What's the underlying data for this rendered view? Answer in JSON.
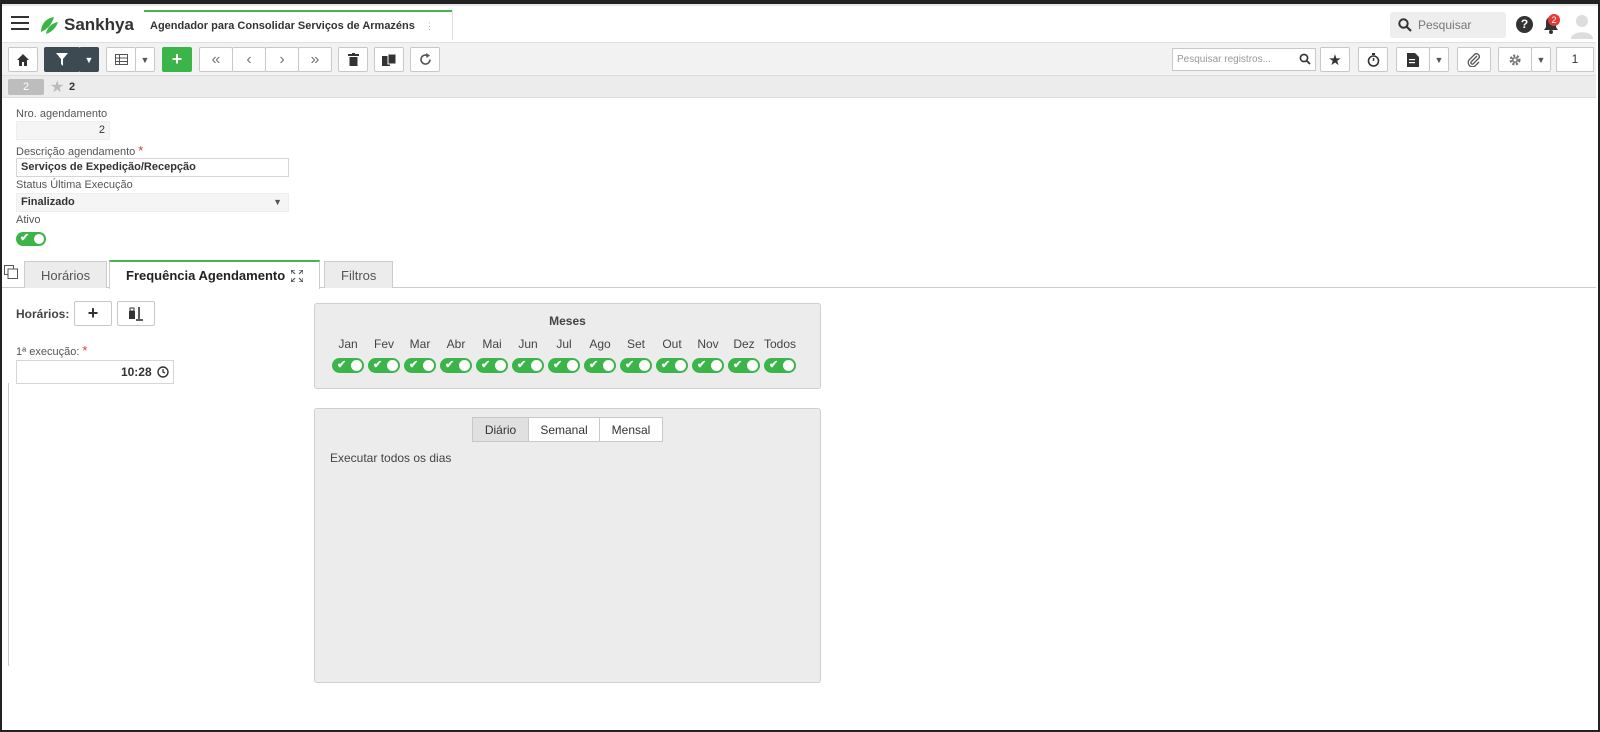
{
  "header": {
    "logo_text": "Sankhya",
    "app_tab_title": "Agendador para Consolidar Serviços de Armazéns",
    "search_placeholder": "Pesquisar",
    "notification_count": "2"
  },
  "toolbar": {
    "search_placeholder": "Pesquisar registros...",
    "page_number": "1"
  },
  "record_strip": {
    "record_badge": "2",
    "favorites_count": "2"
  },
  "form": {
    "nro_label": "Nro. agendamento",
    "nro_value": "2",
    "descricao_label": "Descrição agendamento",
    "descricao_value": "Serviços de Expedição/Recepção",
    "status_label": "Status Última Execução",
    "status_value": "Finalizado",
    "ativo_label": "Ativo",
    "ativo_on": true
  },
  "tabs": [
    {
      "label": "Horários"
    },
    {
      "label": "Frequência Agendamento"
    },
    {
      "label": "Filtros"
    }
  ],
  "horarios": {
    "label": "Horários:",
    "first_exec_label": "1ª execução:",
    "first_exec_value": "10:28"
  },
  "months_panel": {
    "title": "Meses",
    "months": [
      "Jan",
      "Fev",
      "Mar",
      "Abr",
      "Mai",
      "Jun",
      "Jul",
      "Ago",
      "Set",
      "Out",
      "Nov",
      "Dez",
      "Todos"
    ]
  },
  "frequency_panel": {
    "options": [
      "Diário",
      "Semanal",
      "Mensal"
    ],
    "selected": "Diário",
    "description": "Executar todos os dias"
  },
  "colors": {
    "accent_green": "#3bb54a",
    "toolbar_dark": "#3e4a52",
    "badge_red": "#e53935"
  }
}
